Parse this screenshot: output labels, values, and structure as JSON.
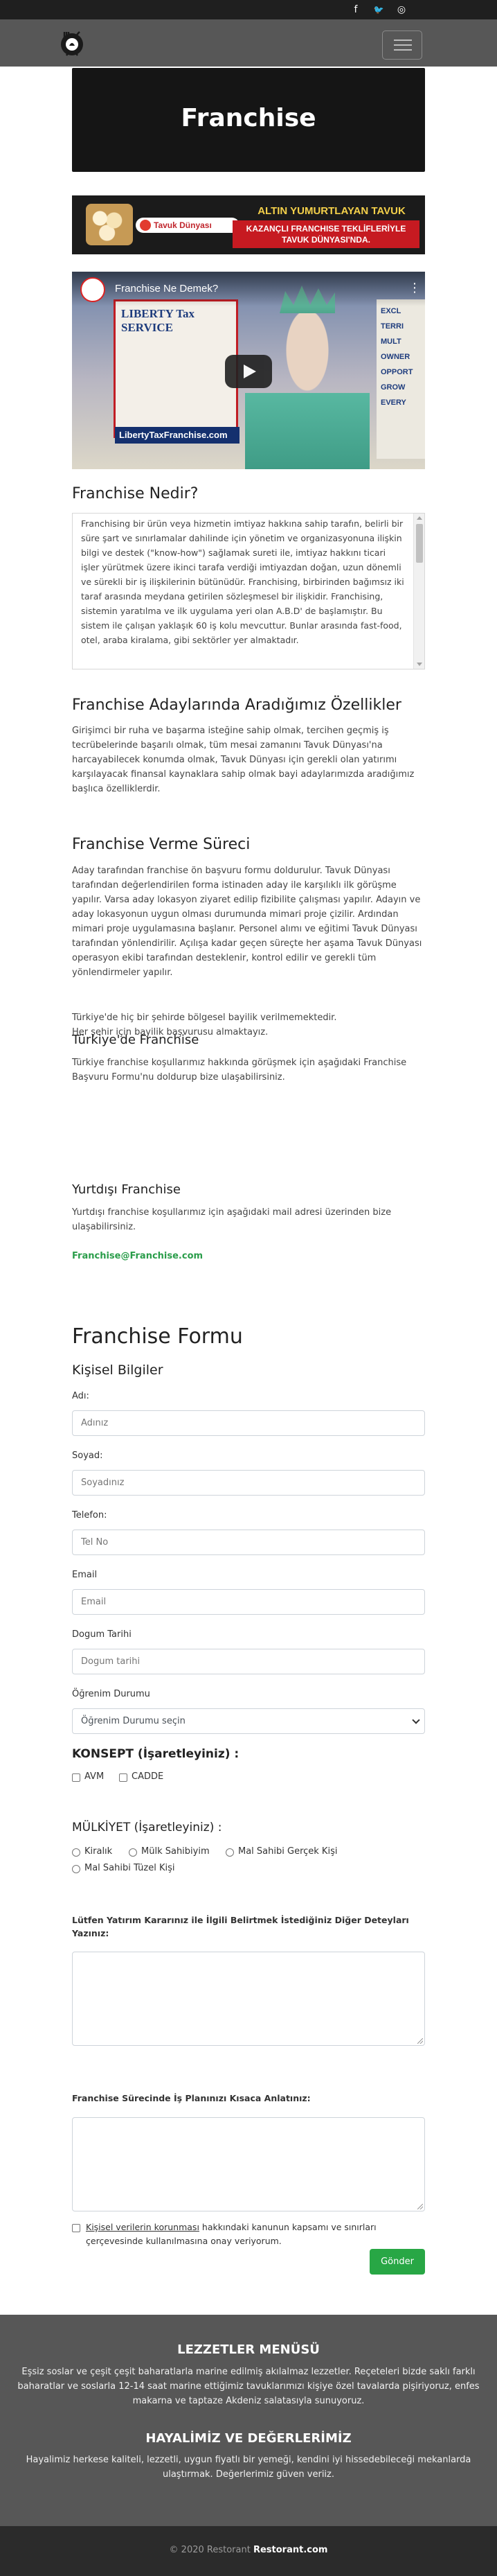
{
  "topbar": {
    "social": [
      {
        "name": "facebook-icon",
        "glyph": "f"
      },
      {
        "name": "twitter-icon",
        "glyph": "🐦"
      },
      {
        "name": "instagram-icon",
        "glyph": "◎"
      }
    ]
  },
  "hero": {
    "title": "Franchise"
  },
  "banner": {
    "brand": "Tavuk Dünyası",
    "headline": "ALTIN YUMURTLAYAN TAVUK",
    "sub": "KAZANÇLI FRANCHISE TEKLİFLERİYLE TAVUK DÜNYASI'NDA."
  },
  "video": {
    "title": "Franchise Ne Demek?",
    "poster_text": "LIBERTY Tax SERVICE",
    "url_text": "LibertyTaxFranchise.com",
    "side_text": "EXCL TERRI MULT OWNER OPPORT GROW EVERY"
  },
  "sections": {
    "what": {
      "title": "Franchise Nedir?",
      "text": "Franchising bir ürün veya hizmetin imtiyaz hakkına sahip tarafın, belirli bir süre şart ve sınırlamalar dahilinde için yönetim ve organizasyonuna ilişkin bilgi ve destek (\"know-how\") sağlamak sureti ile, imtiyaz hakkını ticari işler yürütmek üzere ikinci tarafa verdiği imtiyazdan doğan, uzun dönemli ve sürekli bir iş ilişkilerinin bütünüdür. Franchising, birbirinden bağımsız iki taraf arasında meydana getirilen sözleşmesel bir ilişkidir. Franchising, sistemin yaratılma ve ilk uygulama yeri olan A.B.D' de başlamıştır. Bu sistem ile çalışan yaklaşık 60 iş kolu mevcuttur. Bunlar arasında fast-food, otel, araba kiralama, gibi sektörler yer almaktadır."
    },
    "features": {
      "title": "Franchise Adaylarında Aradığımız Özellikler",
      "text": "Girişimci bir ruha ve başarma isteğine sahip olmak, tercihen geçmiş iş tecrübelerinde başarılı olmak, tüm mesai zamanını Tavuk Dünyası'na harcayabilecek konumda olmak, Tavuk Dünyası için gerekli olan yatırımı karşılayacak finansal kaynaklara sahip olmak bayi adaylarımızda aradığımız başlıca özelliklerdir."
    },
    "process": {
      "title": "Franchise Verme Süreci",
      "text1": "Aday tarafından franchise ön başvuru formu doldurulur. Tavuk Dünyası tarafından değerlendirilen forma istinaden aday ile karşılıklı ilk görüşme yapılır. Varsa aday lokasyon ziyaret edilip fizibilite çalışması yapılır. Adayın ve aday lokasyonun uygun olması durumunda mimari proje çizilir. Ardından mimari proje uygulamasına başlanır. Personel alımı ve eğitimi Tavuk Dünyası tarafından yönlendirilir. Açılışa kadar geçen süreçte her aşama Tavuk Dünyası operasyon ekibi tarafından desteklenir, kontrol edilir ve gerekli tüm yönlendirmeler yapılır.",
      "text2": "Türkiye'de hiç bir şehirde bölgesel bayilik verilmemektedir.",
      "text3": "Her şehir için bayilik başvurusu almaktayız."
    },
    "turkey": {
      "title": "Türkiye'de Franchise",
      "text": "Türkiye franchise koşullarımız hakkında görüşmek için aşağıdaki Franchise Başvuru Formu'nu doldurup bize ulaşabilirsiniz."
    },
    "abroad": {
      "title": "Yurtdışı Franchise",
      "text": "Yurtdışı franchise koşullarımız için aşağıdaki mail adresi üzerinden bize ulaşabilirsiniz.",
      "email": "Franchise@Franchise.com"
    }
  },
  "form": {
    "title": "Franchise Formu",
    "subtitle": "Kişisel Bilgiler",
    "fields": {
      "name": {
        "label": "Adı:",
        "placeholder": "Adınız"
      },
      "surname": {
        "label": "Soyad:",
        "placeholder": "Soyadınız"
      },
      "phone": {
        "label": "Telefon:",
        "placeholder": "Tel No"
      },
      "email": {
        "label": "Email",
        "placeholder": "Email"
      },
      "birth": {
        "label": "Dogum Tarihi",
        "placeholder": "Dogum tarihi"
      },
      "education": {
        "label": "Öğrenim Durumu",
        "selected": "Öğrenim Durumu seçin"
      }
    },
    "concept": {
      "title": "KONSEPT (İşaretleyiniz) :",
      "options": [
        "AVM",
        "CADDE"
      ]
    },
    "ownership": {
      "title": "MÜLKİYET (İşaretleyiniz) :",
      "options": [
        "Kiralık",
        "Mülk Sahibiyim",
        "Mal Sahibi Gerçek Kişi",
        "Mal Sahibi Tüzel Kişi"
      ]
    },
    "invest_label": "Lütfen Yatırım Kararınız ile İlgili Belirtmek İstediğiniz Diğer Deteyları Yazınız:",
    "plan_label": "Franchise Sürecinde İş Planınızı Kısaca Anlatınız:",
    "consent_link": "Kişisel verilerin korunması",
    "consent_rest": " hakkındaki kanunun kapsamı ve sınırları çerçevesinde kullanılmasına onay veriyorum.",
    "submit": "Gönder"
  },
  "footer": {
    "menu_title": "LEZZETLER MENÜSÜ",
    "menu_text": "Eşsiz soslar ve çeşit çeşit baharatlarla marine edilmiş akılalmaz lezzetler. Reçeteleri bizde saklı farklı baharatlar ve soslarla 12-14 saat marine ettiğimiz tavuklarımızı kişiye özel tavalarda pişiriyoruz, enfes makarna ve taptaze Akdeniz salatasıyla sunuyoruz.",
    "values_title": "HAYALİMİZ VE DEĞERLERİMİZ",
    "values_text": "Hayalimiz herkese kaliteli, lezzetli, uygun fiyatlı bir yemeği, kendini iyi hissedebileceği mekanlarda ulaştırmak. Değerlerimiz güven veriiz.",
    "copy_prefix": "© 2020 Restorant ",
    "copy_brand": "Restorant.com"
  }
}
